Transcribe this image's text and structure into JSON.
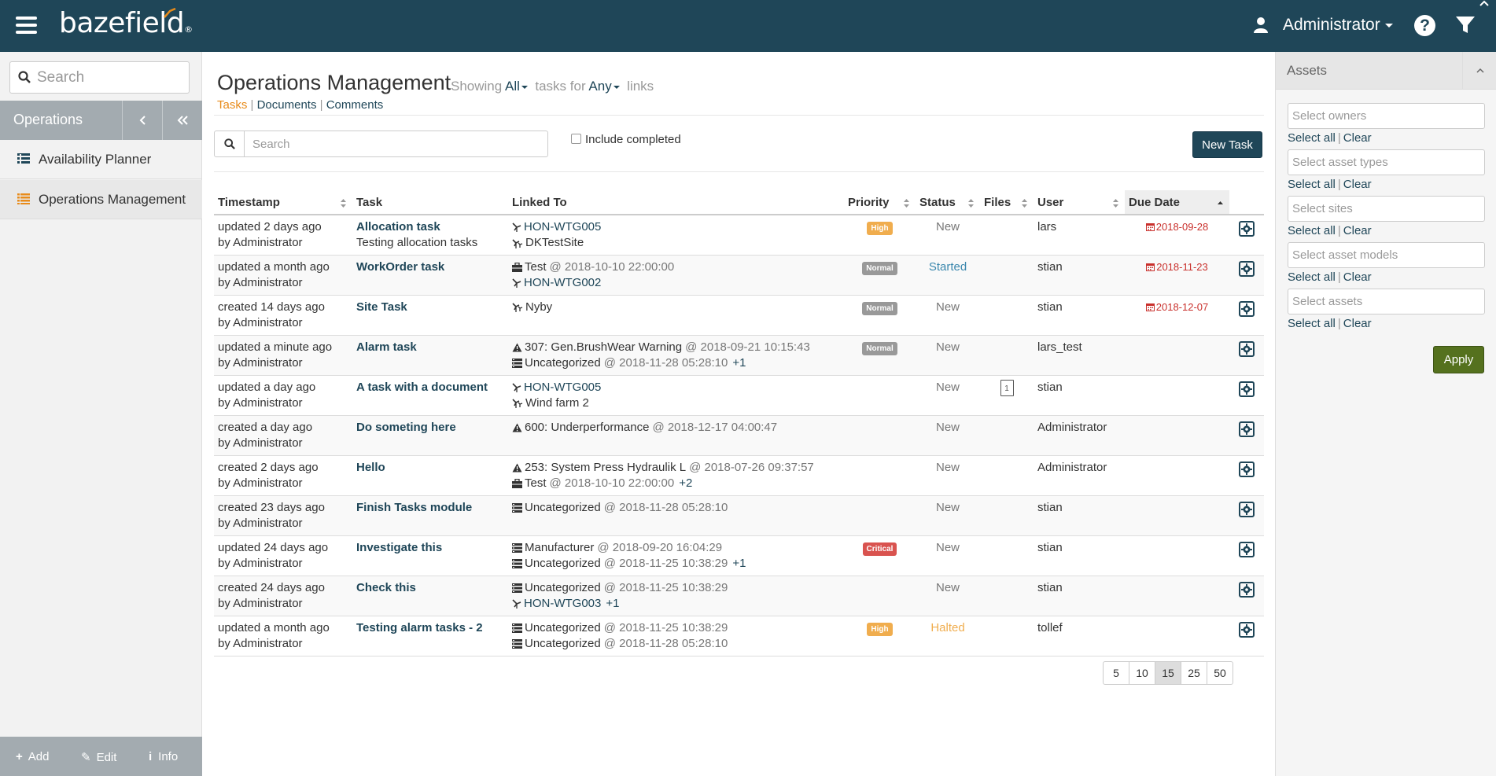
{
  "header": {
    "logo": "bazefield",
    "logo_reg": "®",
    "user": "Administrator",
    "help": "?"
  },
  "sidebar": {
    "search_placeholder": "Search",
    "section": "Operations",
    "items": [
      {
        "label": "Availability Planner",
        "icon": "calendar-list-icon"
      },
      {
        "label": "Operations Management",
        "icon": "list-icon"
      }
    ],
    "footer": {
      "add": "Add",
      "edit": "Edit",
      "info": "Info"
    }
  },
  "main": {
    "title": "Operations Management",
    "subtitle": {
      "showing": "Showing",
      "filter1": "All",
      "tasks_for": "tasks for",
      "filter2": "Any",
      "links": "links"
    },
    "tabs": [
      "Tasks",
      "Documents",
      "Comments"
    ],
    "search_placeholder": "Search",
    "include_completed": "Include completed",
    "new_task": "New Task",
    "columns": [
      "Timestamp",
      "Task",
      "Linked To",
      "Priority",
      "Status",
      "Files",
      "User",
      "Due Date"
    ],
    "rows": [
      {
        "ts": "updated 2 days ago",
        "by": "by Administrator",
        "task": "Allocation task",
        "task_sub": "Testing allocation tasks",
        "links": [
          {
            "icon": "turbine",
            "text": "HON-WTG005",
            "is_link": true
          },
          {
            "icon": "windfarm",
            "text": "DKTestSite",
            "is_link": false
          }
        ],
        "priority": "High",
        "pcls": "b-high",
        "status": "New",
        "scls": "st-new",
        "files": "",
        "user": "lars",
        "due": "2018-09-28"
      },
      {
        "ts": "updated a month ago",
        "by": "by Administrator",
        "task": "WorkOrder task",
        "task_sub": "",
        "links": [
          {
            "icon": "briefcase",
            "text": "Test",
            "at": "@ 2018-10-10 22:00:00"
          },
          {
            "icon": "turbine",
            "text": "HON-WTG002",
            "is_link": true
          }
        ],
        "priority": "Normal",
        "pcls": "b-normal",
        "status": "Started",
        "scls": "st-started",
        "files": "",
        "user": "stian",
        "due": "2018-11-23"
      },
      {
        "ts": "created 14 days ago",
        "by": "by Administrator",
        "task": "Site Task",
        "task_sub": "",
        "links": [
          {
            "icon": "windfarm",
            "text": "Nyby"
          }
        ],
        "priority": "Normal",
        "pcls": "b-normal",
        "status": "New",
        "scls": "st-new",
        "files": "",
        "user": "stian",
        "due": "2018-12-07"
      },
      {
        "ts": "updated a minute ago",
        "by": "by Administrator",
        "task": "Alarm task",
        "task_sub": "",
        "links": [
          {
            "icon": "warning",
            "text": "307: Gen.BrushWear Warning",
            "at": "@ 2018-09-21 10:15:43"
          },
          {
            "icon": "server",
            "text": "Uncategorized",
            "at": "@ 2018-11-28 05:28:10",
            "plus": "+1"
          }
        ],
        "priority": "Normal",
        "pcls": "b-normal",
        "status": "New",
        "scls": "st-new",
        "files": "",
        "user": "lars_test",
        "due": ""
      },
      {
        "ts": "updated a day ago",
        "by": "by Administrator",
        "task": "A task with a document",
        "task_sub": "",
        "links": [
          {
            "icon": "turbine",
            "text": "HON-WTG005",
            "is_link": true
          },
          {
            "icon": "windfarm",
            "text": "Wind farm 2"
          }
        ],
        "priority": "",
        "pcls": "",
        "status": "New",
        "scls": "st-new",
        "files": "1",
        "user": "stian",
        "due": ""
      },
      {
        "ts": "created a day ago",
        "by": "by Administrator",
        "task": "Do someting here",
        "task_sub": "",
        "links": [
          {
            "icon": "warning",
            "text": "600: Underperformance",
            "at": "@ 2018-12-17 04:00:47"
          }
        ],
        "priority": "",
        "pcls": "",
        "status": "New",
        "scls": "st-new",
        "files": "",
        "user": "Administrator",
        "due": ""
      },
      {
        "ts": "created 2 days ago",
        "by": "by Administrator",
        "task": "Hello",
        "task_sub": "",
        "links": [
          {
            "icon": "warning",
            "text": "253: System Press Hydraulik L",
            "at": "@ 2018-07-26 09:37:57"
          },
          {
            "icon": "briefcase",
            "text": "Test",
            "at": "@ 2018-10-10 22:00:00",
            "plus": "+2"
          }
        ],
        "priority": "",
        "pcls": "",
        "status": "New",
        "scls": "st-new",
        "files": "",
        "user": "Administrator",
        "due": ""
      },
      {
        "ts": "created 23 days ago",
        "by": "by Administrator",
        "task": "Finish Tasks module",
        "task_sub": "",
        "links": [
          {
            "icon": "server",
            "text": "Uncategorized",
            "at": "@ 2018-11-28 05:28:10"
          }
        ],
        "priority": "",
        "pcls": "",
        "status": "New",
        "scls": "st-new",
        "files": "",
        "user": "stian",
        "due": ""
      },
      {
        "ts": "updated 24 days ago",
        "by": "by Administrator",
        "task": "Investigate this",
        "task_sub": "",
        "links": [
          {
            "icon": "server",
            "text": "Manufacturer",
            "at": "@ 2018-09-20 16:04:29"
          },
          {
            "icon": "server",
            "text": "Uncategorized",
            "at": "@ 2018-11-25 10:38:29",
            "plus": "+1"
          }
        ],
        "priority": "Critical",
        "pcls": "b-critical",
        "status": "New",
        "scls": "st-new",
        "files": "",
        "user": "stian",
        "due": ""
      },
      {
        "ts": "created 24 days ago",
        "by": "by Administrator",
        "task": "Check this",
        "task_sub": "",
        "links": [
          {
            "icon": "server",
            "text": "Uncategorized",
            "at": "@ 2018-11-25 10:38:29"
          },
          {
            "icon": "turbine",
            "text": "HON-WTG003",
            "is_link": true,
            "plus": "+1"
          }
        ],
        "priority": "",
        "pcls": "",
        "status": "New",
        "scls": "st-new",
        "files": "",
        "user": "stian",
        "due": ""
      },
      {
        "ts": "updated a month ago",
        "by": "by Administrator",
        "task": "Testing alarm tasks - 2",
        "task_sub": "",
        "links": [
          {
            "icon": "server",
            "text": "Uncategorized",
            "at": "@ 2018-11-25 10:38:29"
          },
          {
            "icon": "server",
            "text": "Uncategorized",
            "at": "@ 2018-11-28 05:28:10"
          }
        ],
        "priority": "High",
        "pcls": "b-high",
        "status": "Halted",
        "scls": "st-halted",
        "files": "",
        "user": "tollef",
        "due": ""
      }
    ],
    "page_sizes": [
      "5",
      "10",
      "15",
      "25",
      "50"
    ],
    "page_size_active": "15"
  },
  "assets_panel": {
    "title": "Assets",
    "fields": [
      "Select owners",
      "Select asset types",
      "Select sites",
      "Select asset models",
      "Select assets"
    ],
    "select_all": "Select all",
    "clear": "Clear",
    "apply": "Apply"
  },
  "colors": {
    "header": "#1f4658",
    "accent": "#e88b1a",
    "apply": "#55711e",
    "critical": "#d9534f",
    "high": "#f0ad4e"
  }
}
